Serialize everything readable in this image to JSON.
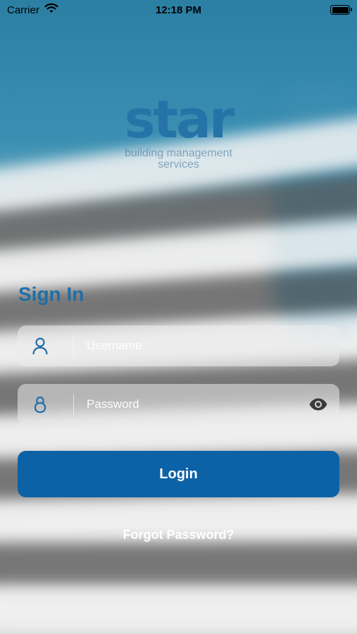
{
  "status_bar": {
    "carrier": "Carrier",
    "time": "12:18 PM",
    "icons": [
      "wifi-icon",
      "battery-icon"
    ]
  },
  "logo": {
    "word": "star",
    "tagline_line1": "building management",
    "tagline_line2": "services"
  },
  "signin": {
    "title": "Sign In",
    "username": {
      "placeholder": "Username",
      "value": "",
      "icon": "user-icon"
    },
    "password": {
      "placeholder": "Password",
      "value": "",
      "icon": "lock-icon",
      "toggle_icon": "eye-icon"
    },
    "login_label": "Login",
    "forgot_label": "Forgot Password?"
  },
  "colors": {
    "brand_blue": "#1f6ea8",
    "button_blue": "#0c62a6",
    "sky": "#2f86a8"
  }
}
